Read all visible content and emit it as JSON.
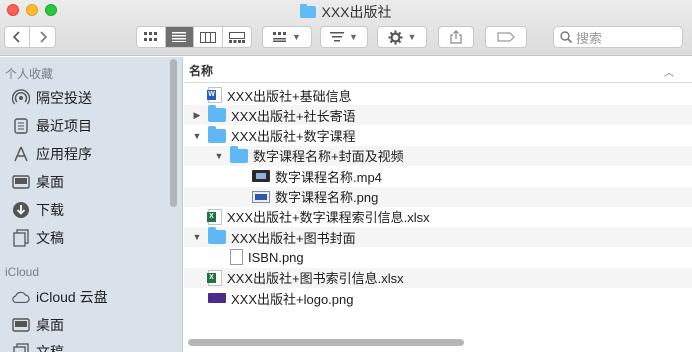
{
  "window": {
    "title": "XXX出版社"
  },
  "toolbar": {
    "back_icon": "chevron-left-icon",
    "forward_icon": "chevron-right-icon",
    "view_modes": [
      "icon-view",
      "list-view",
      "column-view",
      "gallery-view"
    ],
    "active_view": "list-view",
    "search_placeholder": "搜索"
  },
  "sidebar": {
    "favorites_header": "个人收藏",
    "favorites": [
      {
        "label": "隔空投送",
        "icon": "airdrop-icon"
      },
      {
        "label": "最近项目",
        "icon": "recents-icon"
      },
      {
        "label": "应用程序",
        "icon": "applications-icon"
      },
      {
        "label": "桌面",
        "icon": "desktop-icon"
      },
      {
        "label": "下载",
        "icon": "downloads-icon"
      },
      {
        "label": "文稿",
        "icon": "documents-icon"
      }
    ],
    "icloud_header": "iCloud",
    "icloud": [
      {
        "label": "iCloud 云盘",
        "icon": "cloud-icon"
      },
      {
        "label": "桌面",
        "icon": "desktop-icon"
      },
      {
        "label": "文稿",
        "icon": "documents-icon"
      }
    ]
  },
  "list": {
    "column_header": "名称",
    "rows": [
      {
        "name": "XXX出版社+基础信息",
        "type": "word",
        "indent": 0,
        "disclosure": "none"
      },
      {
        "name": "XXX出版社+社长寄语",
        "type": "folder",
        "indent": 0,
        "disclosure": "collapsed"
      },
      {
        "name": "XXX出版社+数字课程",
        "type": "folder",
        "indent": 0,
        "disclosure": "expanded"
      },
      {
        "name": "数字课程名称+封面及视频",
        "type": "folder",
        "indent": 1,
        "disclosure": "expanded"
      },
      {
        "name": "数字课程名称.mp4",
        "type": "video",
        "indent": 2,
        "disclosure": "none"
      },
      {
        "name": "数字课程名称.png",
        "type": "img",
        "indent": 2,
        "disclosure": "none"
      },
      {
        "name": "XXX出版社+数字课程索引信息.xlsx",
        "type": "excel",
        "indent": 0,
        "disclosure": "none"
      },
      {
        "name": "XXX出版社+图书封面",
        "type": "folder",
        "indent": 0,
        "disclosure": "expanded"
      },
      {
        "name": "ISBN.png",
        "type": "page",
        "indent": 1,
        "disclosure": "none"
      },
      {
        "name": "XXX出版社+图书索引信息.xlsx",
        "type": "excel",
        "indent": 0,
        "disclosure": "none"
      },
      {
        "name": "XXX出版社+logo.png",
        "type": "logo",
        "indent": 0,
        "disclosure": "none"
      }
    ]
  }
}
